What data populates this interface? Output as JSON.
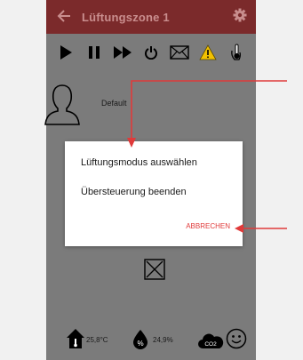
{
  "header": {
    "title": "Lüftungszone 1",
    "back_icon": "arrow-left-icon",
    "settings_icon": "gear-icon"
  },
  "toolbar": {
    "icons": [
      "play-icon",
      "pause-icon",
      "fast-forward-icon",
      "power-icon",
      "mail-icon",
      "warning-icon",
      "thermometer-hand-icon"
    ]
  },
  "profile": {
    "label": "Default",
    "icon": "user-icon"
  },
  "dialog": {
    "option1": "Lüftungsmodus auswählen",
    "option2": "Übersteuerung beenden",
    "cancel": "ABBRECHEN"
  },
  "status": {
    "temperature": "25,8°C",
    "humidity": "24,9%",
    "co2_label": "CO2"
  },
  "colors": {
    "appbar": "#7b2a2b",
    "background": "#7b7b7b",
    "accent": "#e03a3a",
    "warning": "#f2c100"
  }
}
